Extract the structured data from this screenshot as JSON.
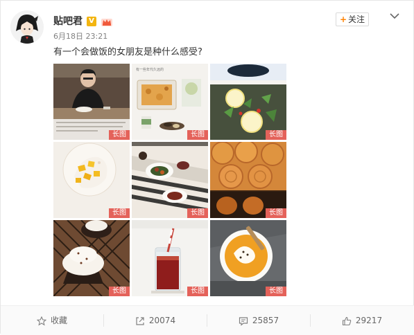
{
  "post": {
    "username": "贴吧君",
    "verified_badge": "V",
    "timestamp": "6月18日 23:21",
    "text": "有一个会做饭的女朋友是种什么感受?",
    "follow_label": "关注",
    "follow_plus": "+",
    "icons": [
      "avatar",
      "verified-v-icon",
      "crown-icon",
      "chevron-down-icon"
    ]
  },
  "images": [
    {
      "tag": "长图",
      "caption_top": "",
      "caption_bottom": "",
      "desc": "man at table"
    },
    {
      "tag": "长图",
      "caption_top": "有一些年代久远的",
      "caption_bottom": "",
      "desc": "baked dish"
    },
    {
      "tag": "长图",
      "caption_top": "",
      "caption_bottom": "",
      "desc": "salad with lemon"
    },
    {
      "tag": "长图",
      "caption_top": "",
      "caption_bottom": "",
      "desc": "mango dessert"
    },
    {
      "tag": "长图",
      "caption_top": "",
      "caption_bottom": "",
      "desc": "plates on table"
    },
    {
      "tag": "长图",
      "caption_top": "",
      "caption_bottom": "",
      "desc": "mooncakes"
    },
    {
      "tag": "长图",
      "caption_top": "",
      "caption_bottom": "",
      "desc": "cupcakes"
    },
    {
      "tag": "长图",
      "caption_top": "",
      "caption_bottom": "",
      "desc": "iced drink"
    },
    {
      "tag": "长图",
      "caption_top": "",
      "caption_bottom": "",
      "desc": "pumpkin soup"
    }
  ],
  "actions": {
    "favorite": {
      "label": "收藏",
      "icon": "star-icon"
    },
    "repost": {
      "count": "20074",
      "icon": "repost-icon"
    },
    "comment": {
      "count": "25857",
      "icon": "comment-icon"
    },
    "like": {
      "count": "29217",
      "icon": "thumbs-up-icon"
    }
  }
}
